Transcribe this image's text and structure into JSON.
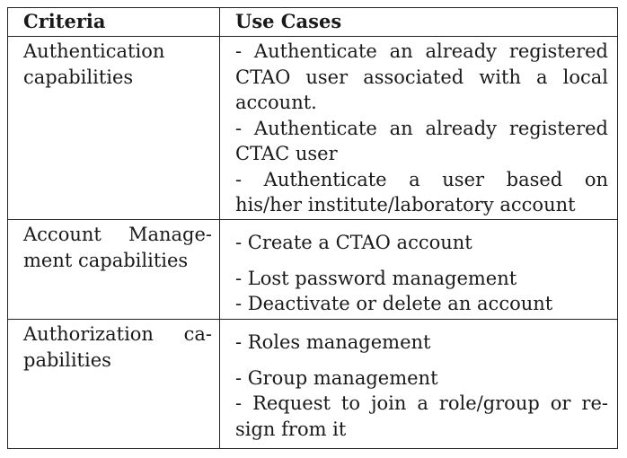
{
  "table": {
    "header": {
      "criteria": "Criteria",
      "use_cases": "Use Cases"
    },
    "rows": [
      {
        "criteria_lines": [
          "Authentication",
          "capabilities"
        ],
        "use_case_lines": [
          "- Authenticate an already registered",
          "CTAO user associated with a local",
          "account.",
          "- Authenticate an already registered",
          "CTAC user",
          "- Authenticate a user based on",
          "his/her institute/laboratory account"
        ]
      },
      {
        "criteria_lines": [
          "Account Manage-",
          "ment capabilities"
        ],
        "use_case_lines": [
          "- Create a CTAO account",
          "- Lost password management",
          "- Deactivate or delete an account"
        ]
      },
      {
        "criteria_lines": [
          "Authorization ca-",
          "pabilities"
        ],
        "use_case_lines": [
          "- Roles management",
          "- Group management",
          "- Request to join a role/group or re-",
          "sign from it"
        ]
      }
    ]
  }
}
